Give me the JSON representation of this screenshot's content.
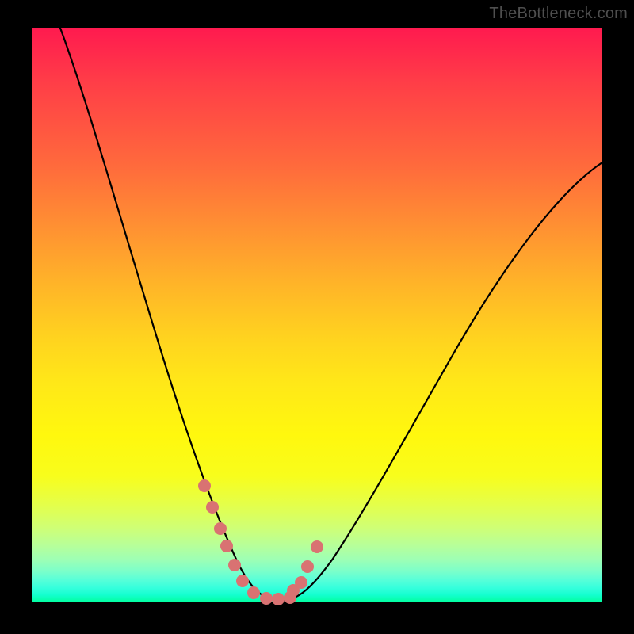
{
  "watermark": "TheBottleneck.com",
  "chart_data": {
    "type": "line",
    "title": "",
    "xlabel": "",
    "ylabel": "",
    "xlim": [
      0,
      100
    ],
    "ylim": [
      0,
      100
    ],
    "grid": false,
    "legend": false,
    "series": [
      {
        "name": "bottleneck-curve",
        "color": "#000000",
        "x": [
          5,
          7,
          10,
          13,
          16,
          19,
          22,
          25,
          27,
          29,
          31,
          33,
          35,
          37,
          38,
          40,
          42,
          44,
          46,
          48,
          51,
          54,
          58,
          62,
          66,
          70,
          75,
          80,
          85,
          90,
          95,
          100
        ],
        "y": [
          100,
          92,
          81,
          71,
          62,
          53,
          45,
          37,
          31,
          26,
          21,
          16,
          12,
          8,
          6,
          3,
          1,
          0,
          0,
          1,
          3,
          7,
          12,
          19,
          26,
          33,
          41,
          49,
          56,
          63,
          70,
          76
        ]
      },
      {
        "name": "highlight-markers",
        "color": "#d97272",
        "marker": "circle",
        "x": [
          30,
          31.5,
          33,
          34,
          35.5,
          37,
          39,
          41,
          43,
          45,
          45.5,
          47,
          48,
          50
        ],
        "y": [
          21,
          17,
          13,
          10,
          7,
          4,
          2,
          0.5,
          0.5,
          0.8,
          2,
          3.5,
          6,
          9
        ]
      }
    ],
    "background": "vertical-gradient red→yellow→green (top=high bottleneck, bottom=none)"
  }
}
